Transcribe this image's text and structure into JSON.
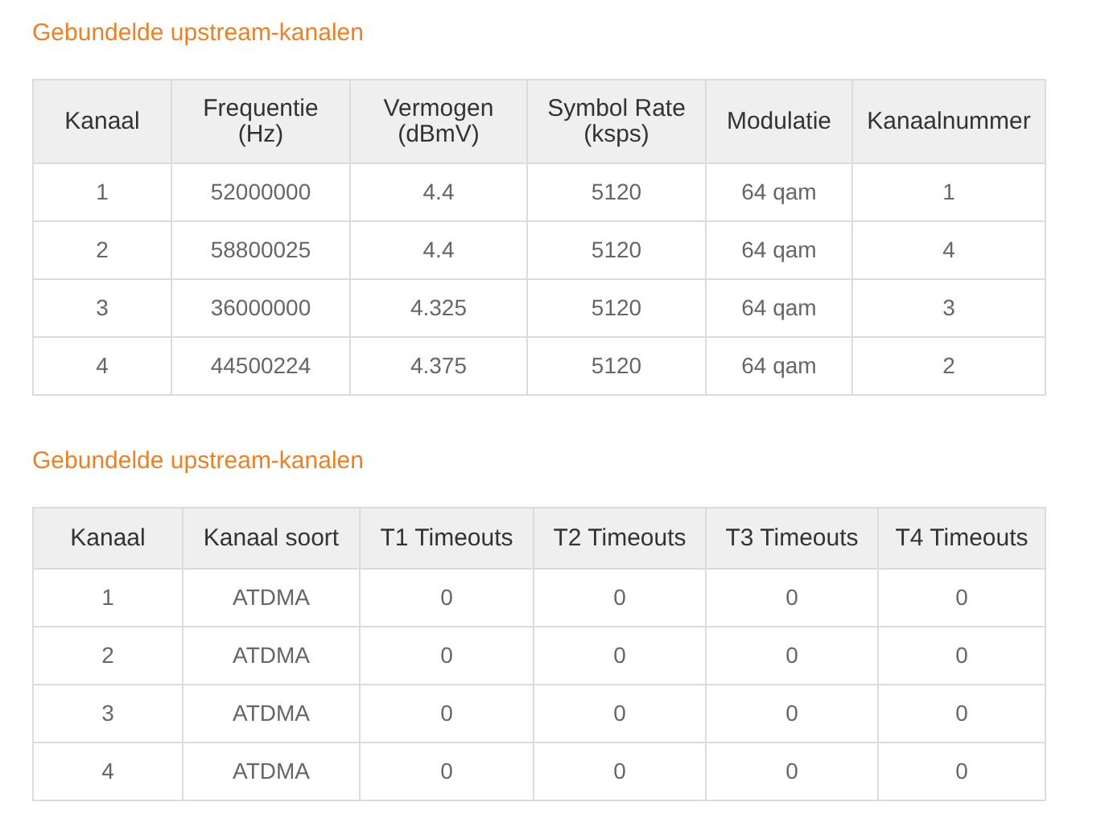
{
  "sections": [
    {
      "title": "Gebundelde upstream-kanalen",
      "table": {
        "columns": [
          "Kanaal",
          "Frequentie (Hz)",
          "Vermogen (dBmV)",
          "Symbol Rate (ksps)",
          "Modulatie",
          "Kanaalnummer"
        ],
        "rows": [
          [
            "1",
            "52000000",
            "4.4",
            "5120",
            "64 qam",
            "1"
          ],
          [
            "2",
            "58800025",
            "4.4",
            "5120",
            "64 qam",
            "4"
          ],
          [
            "3",
            "36000000",
            "4.325",
            "5120",
            "64 qam",
            "3"
          ],
          [
            "4",
            "44500224",
            "4.375",
            "5120",
            "64 qam",
            "2"
          ]
        ]
      }
    },
    {
      "title": "Gebundelde upstream-kanalen",
      "table": {
        "columns": [
          "Kanaal",
          "Kanaal soort",
          "T1 Timeouts",
          "T2 Timeouts",
          "T3 Timeouts",
          "T4 Timeouts"
        ],
        "rows": [
          [
            "1",
            "ATDMA",
            "0",
            "0",
            "0",
            "0"
          ],
          [
            "2",
            "ATDMA",
            "0",
            "0",
            "0",
            "0"
          ],
          [
            "3",
            "ATDMA",
            "0",
            "0",
            "0",
            "0"
          ],
          [
            "4",
            "ATDMA",
            "0",
            "0",
            "0",
            "0"
          ]
        ]
      }
    }
  ]
}
